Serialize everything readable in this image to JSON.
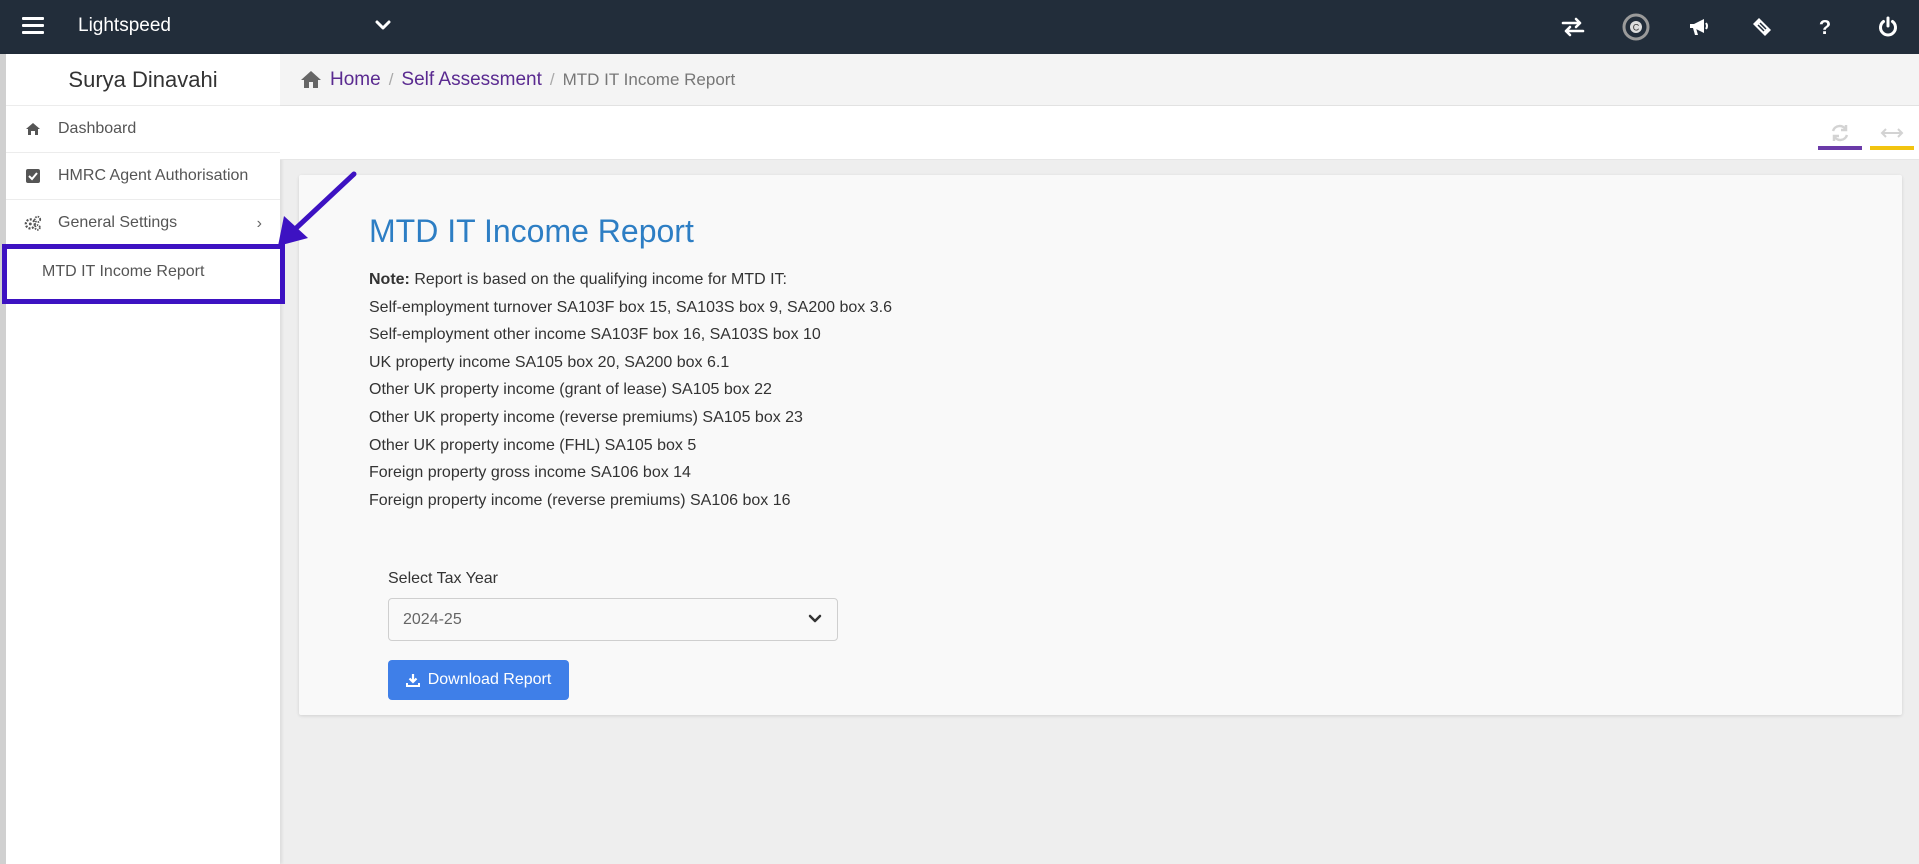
{
  "header": {
    "app_title": "Lightspeed",
    "icons": [
      "hamburger-icon",
      "chevron-down-icon",
      "switch-icon",
      "c-logo-icon",
      "megaphone-icon",
      "ticket-icon",
      "help-icon",
      "power-icon"
    ]
  },
  "sidebar": {
    "user_name": "Surya Dinavahi",
    "items": [
      {
        "label": "Dashboard",
        "icon": "home-icon"
      },
      {
        "label": "HMRC Agent Authorisation",
        "icon": "checkbox-icon"
      },
      {
        "label": "General Settings",
        "icon": "gears-icon"
      }
    ],
    "sub_item": {
      "label": "MTD IT Income Report"
    },
    "arrow_glyph": "›"
  },
  "breadcrumb": {
    "home": "Home",
    "section": "Self Assessment",
    "current": "MTD IT Income Report",
    "separator": "/"
  },
  "toolbar": {
    "accent_colors": {
      "refresh": "#6a3aa8",
      "expand": "#f2c40f"
    }
  },
  "main": {
    "title": "MTD IT Income Report",
    "note_label": "Note:",
    "note_text": " Report is based on the qualifying income for MTD IT:",
    "lines": [
      "Self-employment turnover SA103F box 15, SA103S box 9, SA200 box 3.6",
      "Self-employment other income SA103F box 16, SA103S box 10",
      "UK property income SA105 box 20, SA200 box 6.1",
      "Other UK property income (grant of lease) SA105 box 22",
      "Other UK property income (reverse premiums) SA105 box 23",
      "Other UK property income (FHL) SA105 box 5",
      "Foreign property gross income SA106 box 14",
      "Foreign property income (reverse premiums) SA106 box 16"
    ],
    "select_label": "Select Tax Year",
    "select_value": "2024-25",
    "download_label": "Download Report"
  },
  "colors": {
    "topbar": "#222d3a",
    "title_blue": "#2d7ec4",
    "link_purple": "#5a2a90",
    "button_blue": "#3f7fe8",
    "highlight": "#3d12c2"
  }
}
